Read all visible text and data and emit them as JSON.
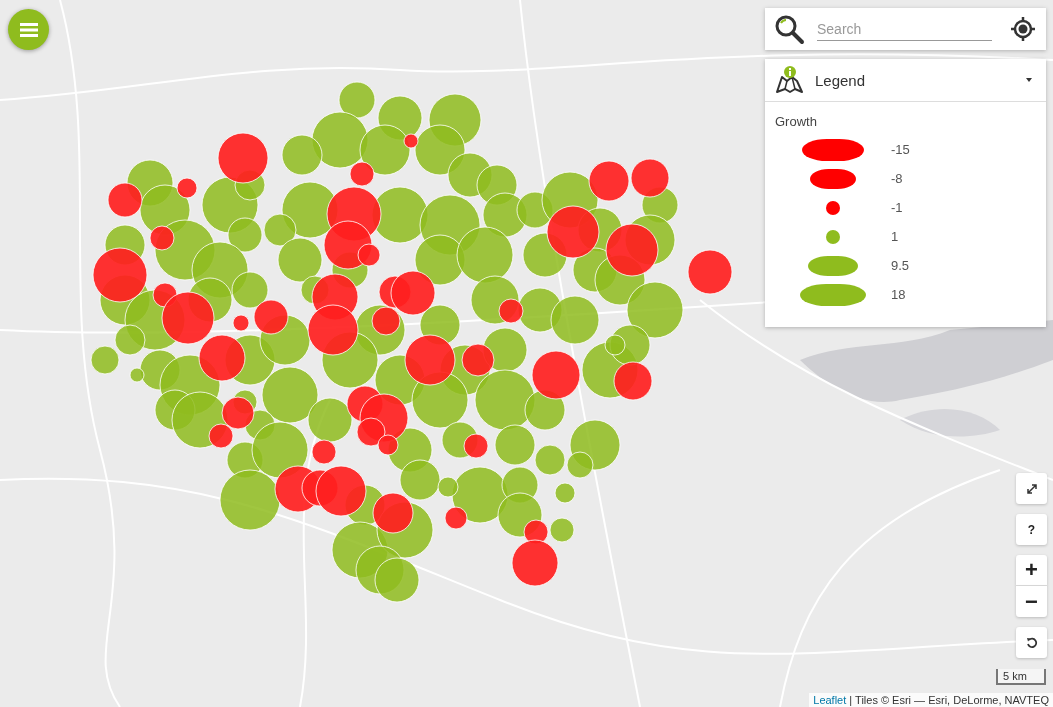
{
  "search": {
    "placeholder": "Search"
  },
  "legend": {
    "title": "Legend",
    "expanded": true,
    "heading": "Growth",
    "items": [
      {
        "label": "-15",
        "kind": "bar",
        "color": "#ff0000"
      },
      {
        "label": "-8",
        "kind": "bar",
        "color": "#ff0000"
      },
      {
        "label": "-1",
        "kind": "dot",
        "color": "#ff0000"
      },
      {
        "label": "1",
        "kind": "dot",
        "color": "#8fbc1e"
      },
      {
        "label": "9.5",
        "kind": "bar",
        "color": "#8fbc1e"
      },
      {
        "label": "18",
        "kind": "bar",
        "color": "#8fbc1e"
      }
    ]
  },
  "controls": [
    {
      "kind": "fullscreen"
    },
    {
      "kind": "text",
      "label": "?"
    },
    {
      "kind": "zoom",
      "plus": "+",
      "minus": "−"
    },
    {
      "kind": "reset"
    }
  ],
  "scale": "5 km",
  "attribution": {
    "link": "Leaflet",
    "text": "| Tiles © Esri — Esri, DeLorme, NAVTEQ"
  }
}
